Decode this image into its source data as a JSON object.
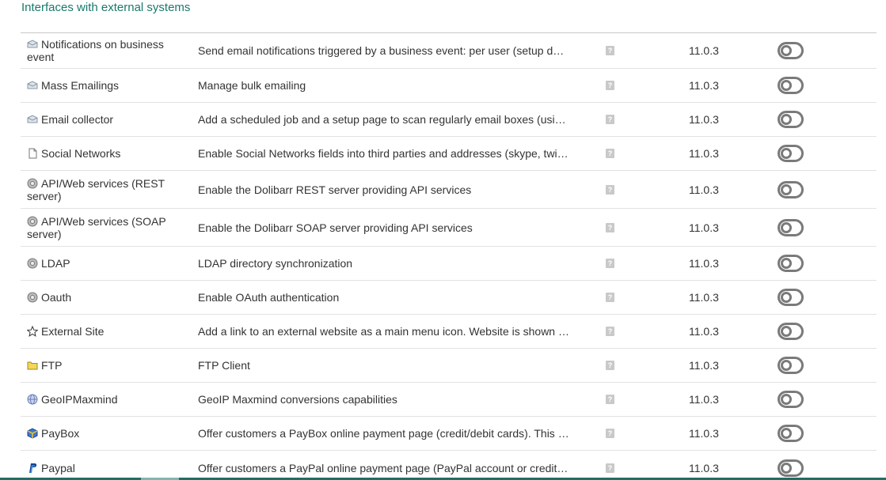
{
  "section": {
    "title": "Interfaces with external systems"
  },
  "modules": [
    {
      "name": "Notifications on business event",
      "icon": "email-icon",
      "description": "Send email notifications triggered by a business event: per user (setup de…",
      "help": "?",
      "version": "11.0.3"
    },
    {
      "name": "Mass Emailings",
      "icon": "email-icon",
      "description": "Manage bulk emailing",
      "help": "?",
      "version": "11.0.3"
    },
    {
      "name": "Email collector",
      "icon": "email-icon",
      "description": "Add a scheduled job and a setup page to scan regularly email boxes (usi…",
      "help": "?",
      "version": "11.0.3"
    },
    {
      "name": "Social Networks",
      "icon": "document-icon",
      "description": "Enable Social Networks fields into third parties and addresses (skype, twit…",
      "help": "?",
      "version": "11.0.3"
    },
    {
      "name": "API/Web services (REST server)",
      "icon": "gear-icon",
      "description": "Enable the Dolibarr REST server providing API services",
      "help": "?",
      "version": "11.0.3"
    },
    {
      "name": "API/Web services (SOAP server)",
      "icon": "gear-icon",
      "description": "Enable the Dolibarr SOAP server providing API services",
      "help": "?",
      "version": "11.0.3"
    },
    {
      "name": "LDAP",
      "icon": "gear-icon",
      "description": "LDAP directory synchronization",
      "help": "?",
      "version": "11.0.3"
    },
    {
      "name": "Oauth",
      "icon": "gear-icon",
      "description": "Enable OAuth authentication",
      "help": "?",
      "version": "11.0.3"
    },
    {
      "name": "External Site",
      "icon": "star-icon",
      "description": "Add a link to an external website as a main menu icon. Website is shown …",
      "help": "?",
      "version": "11.0.3"
    },
    {
      "name": "FTP",
      "icon": "folder-icon",
      "description": "FTP Client",
      "help": "?",
      "version": "11.0.3"
    },
    {
      "name": "GeoIPMaxmind",
      "icon": "globe-icon",
      "description": "GeoIP Maxmind conversions capabilities",
      "help": "?",
      "version": "11.0.3"
    },
    {
      "name": "PayBox",
      "icon": "paybox-icon",
      "description": "Offer customers a PayBox online payment page (credit/debit cards). This …",
      "help": "?",
      "version": "11.0.3"
    },
    {
      "name": "Paypal",
      "icon": "paypal-icon",
      "description": "Offer customers a PayPal online payment page (PayPal account or credit/…",
      "help": "?",
      "version": "11.0.3"
    }
  ],
  "colors": {
    "title": "#19796d",
    "toggle_off": "#7a7a7a",
    "bottom_bar": "#1f6f63"
  }
}
